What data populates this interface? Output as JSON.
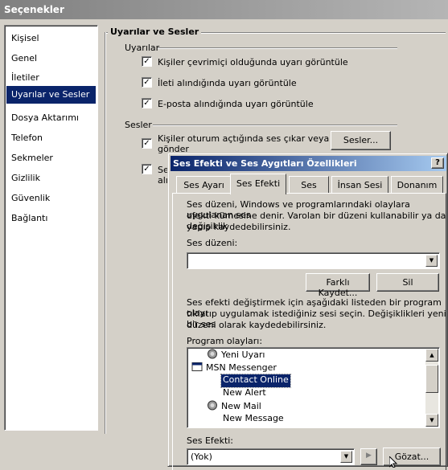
{
  "outer_window": {
    "title": "Seçenekler"
  },
  "sidebar": {
    "items": [
      {
        "label": "Kişisel"
      },
      {
        "label": "Genel"
      },
      {
        "label": "İletiler"
      },
      {
        "label": "Uyarılar ve Sesler",
        "selected": true
      },
      {
        "label": "Dosya Aktarımı"
      },
      {
        "label": "Telefon"
      },
      {
        "label": "Sekmeler"
      },
      {
        "label": "Gizlilik"
      },
      {
        "label": "Güvenlik"
      },
      {
        "label": "Bağlantı"
      }
    ]
  },
  "panel": {
    "title": "Uyarılar ve Sesler",
    "alerts_group": "Uyarılar",
    "alerts": [
      {
        "label": "Kişiler çevrimiçi olduğunda uyarı görüntüle",
        "checked": true
      },
      {
        "label": "İleti alındığında uyarı görüntüle",
        "checked": true
      },
      {
        "label": "E-posta alındığında uyarı görüntüle",
        "checked": true
      }
    ],
    "sounds_group": "Sesler",
    "sound_option_1_line1": "Kişiler oturum açtığında ses çıkar veya ileti",
    "sound_option_1_line2": "gönder",
    "sound_option_2_line1": "Se",
    "sound_option_2_line2": "alın",
    "sounds_button": "Sesler..."
  },
  "inner_dialog": {
    "title": "Ses Efekti ve Ses Aygıtları Özellikleri",
    "help_button": "?",
    "tabs": [
      {
        "label": "Ses Ayarı"
      },
      {
        "label": "Ses Efekti",
        "active": true
      },
      {
        "label": "Ses"
      },
      {
        "label": "İnsan Sesi"
      },
      {
        "label": "Donanım"
      }
    ],
    "description_line1": "Ses düzeni, Windows ve programlarındaki olaylara uygulanan ses",
    "description_line2": "efekti kümesine denir. Varolan bir düzeni kullanabilir ya da değişiklik",
    "description_line3": "yapıp kaydedebilirsiniz.",
    "scheme_label": "Ses düzeni:",
    "scheme_value": "",
    "save_as_button": "Farklı Kaydet...",
    "delete_button": "Sil",
    "instructions_line1": "Ses efekti değiştirmek için aşağıdaki listeden bir program olayı",
    "instructions_line2": "tıklatıp uygulamak istediğiniz sesi seçin. Değişiklikleri yeni bir ses",
    "instructions_line3": "düzeni olarak kaydedebilirsiniz.",
    "program_events_label": "Program olayları:",
    "events": [
      {
        "label": "Yeni Uyarı",
        "icon": "speaker-icon",
        "level": 1
      },
      {
        "label": "MSN Messenger",
        "icon": "window-icon",
        "level": 0
      },
      {
        "label": "Contact Online",
        "icon": "none",
        "level": 2,
        "selected": true
      },
      {
        "label": "New Alert",
        "icon": "none",
        "level": 2
      },
      {
        "label": "New Mail",
        "icon": "speaker-icon",
        "level": 1
      },
      {
        "label": "New Message",
        "icon": "none",
        "level": 2
      }
    ],
    "sound_label": "Ses Efekti:",
    "sound_value": "(Yok)",
    "play_icon": "play-triangle",
    "browse_button": "Gözat..."
  }
}
